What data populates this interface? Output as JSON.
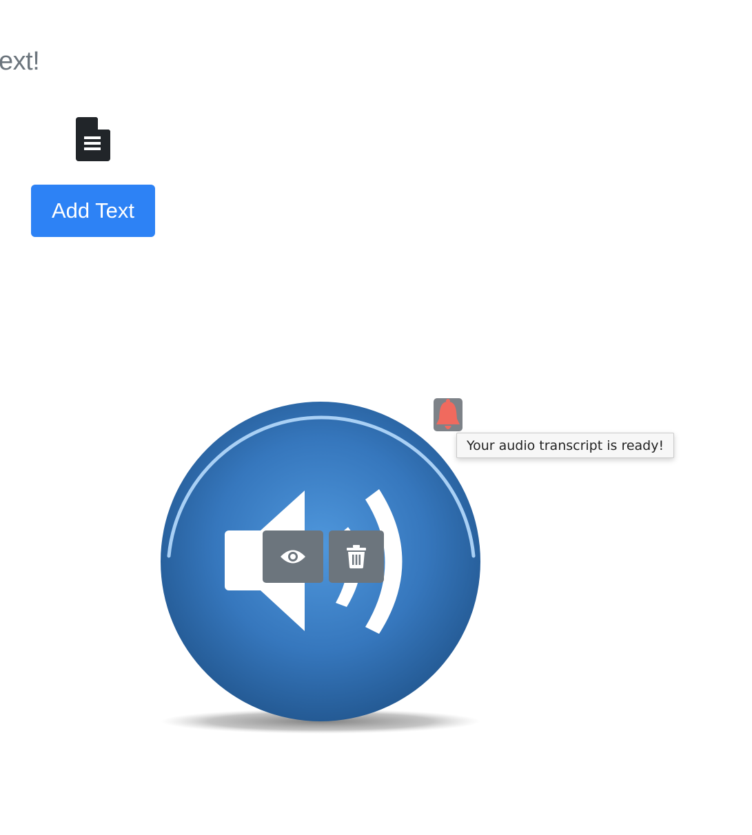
{
  "header": {
    "heading_fragment": "ext!"
  },
  "document": {
    "icon": "file-text-icon",
    "add_button_label": "Add Text"
  },
  "audio": {
    "icon": "speaker-volume-icon",
    "view_icon": "eye-icon",
    "delete_icon": "trash-icon"
  },
  "notification": {
    "icon": "bell-icon",
    "tooltip": "Your audio transcript is ready!"
  },
  "colors": {
    "primary": "#2d82f5",
    "secondary": "#6c757d",
    "alert": "#f06a5e",
    "audio_blue": "#2e6aa8"
  }
}
